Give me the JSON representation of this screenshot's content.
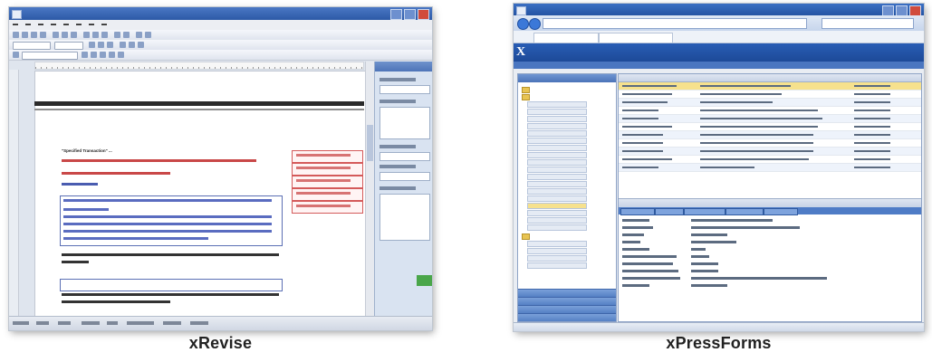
{
  "screenshots": [
    {
      "caption": "xRevise",
      "heading_text": "\"Specified Transaction\" ...",
      "app": "word-processor"
    },
    {
      "caption": "xPressForms",
      "app": "browser-form-manager",
      "logo_letter": "X"
    }
  ],
  "colors": {
    "caption": "#222222",
    "word_blue": "#2d5aa7",
    "ie_blue": "#1d4a98",
    "selected_row": "#f6e18d",
    "revision_red": "#c94848"
  }
}
